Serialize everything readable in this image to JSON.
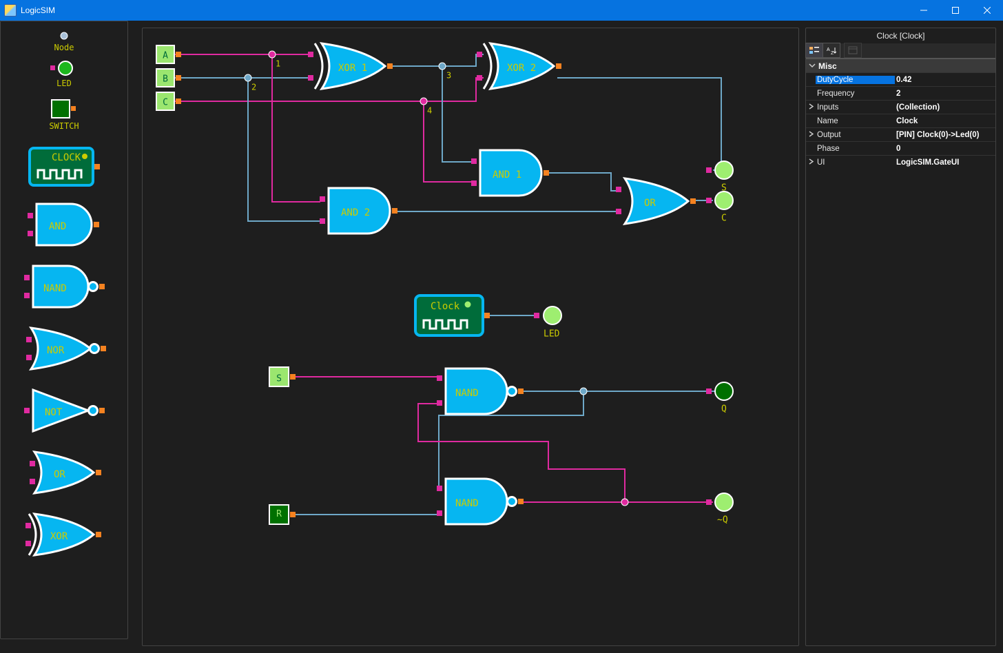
{
  "app": {
    "title": "LogicSIM"
  },
  "palette": {
    "node": "Node",
    "led": "LED",
    "switch": "SWITCH",
    "clock": "CLOCK",
    "and": "AND",
    "nand": "NAND",
    "nor": "NOR",
    "not": "NOT",
    "or": "OR",
    "xor": "XOR"
  },
  "canvas": {
    "clock_label": "Clock",
    "led_label": "LED",
    "switches": {
      "A": "A",
      "B": "B",
      "C": "C",
      "S": "S",
      "R": "R"
    },
    "leds": {
      "S": "S",
      "C": "C",
      "Q": "Q",
      "nQ": "~Q"
    },
    "nodes": {
      "1": "1",
      "2": "2",
      "3": "3",
      "4": "4"
    },
    "gates": {
      "xor1": "XOR 1",
      "xor2": "XOR 2",
      "and1": "AND 1",
      "and2": "AND 2",
      "or": "OR",
      "nand1": "NAND",
      "nand2": "NAND"
    }
  },
  "props": {
    "title": "Clock [Clock]",
    "category": "Misc",
    "rows": [
      {
        "name": "DutyCycle",
        "value": "0.42",
        "selected": true,
        "exp": ""
      },
      {
        "name": "Frequency",
        "value": "2",
        "exp": ""
      },
      {
        "name": "Inputs",
        "value": "(Collection)",
        "exp": ">"
      },
      {
        "name": "Name",
        "value": "Clock",
        "exp": ""
      },
      {
        "name": "Output",
        "value": "[PIN] Clock(0)->Led(0)",
        "exp": ">"
      },
      {
        "name": "Phase",
        "value": "0",
        "exp": ""
      },
      {
        "name": "UI",
        "value": "LogicSIM.GateUI",
        "exp": ">"
      }
    ]
  }
}
